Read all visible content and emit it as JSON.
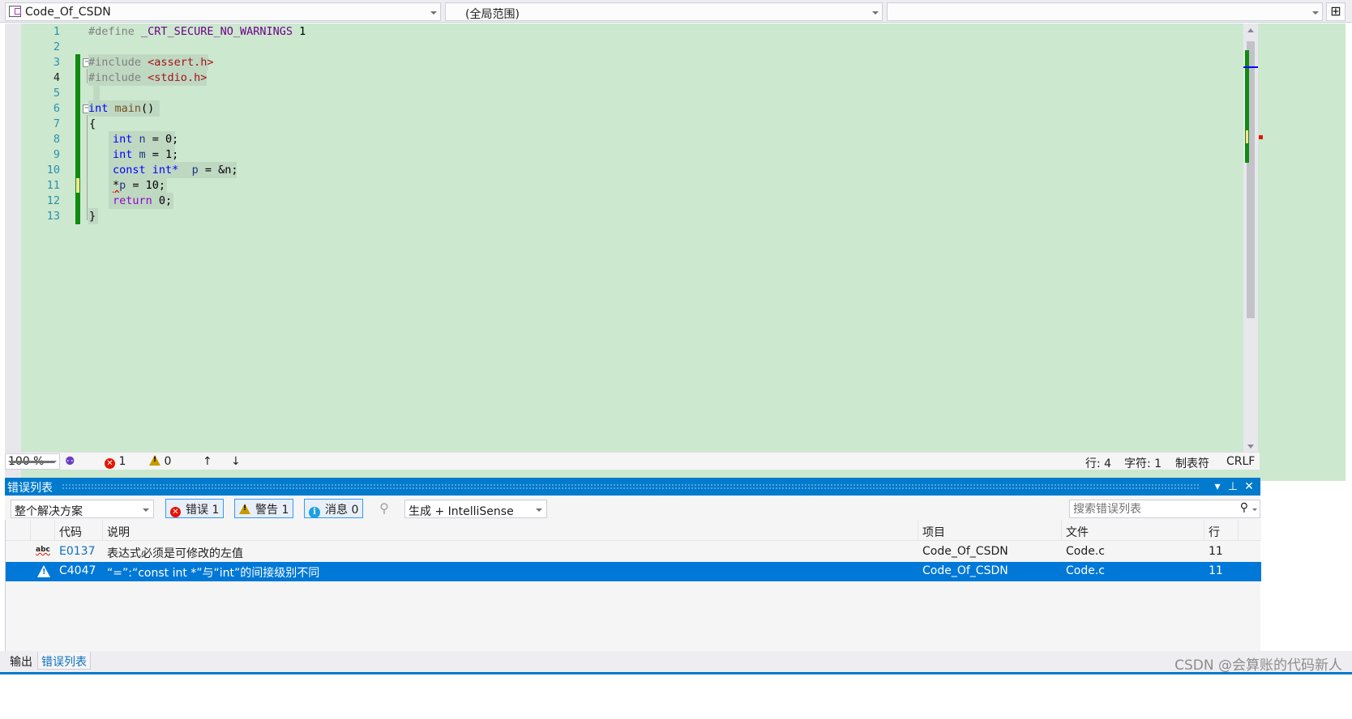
{
  "navbar": {
    "project": "Code_Of_CSDN",
    "scope": "(全局范围)",
    "member": "",
    "split_icon": "split-window-icon",
    "split_glyph": "⊞"
  },
  "editor": {
    "lines": [
      {
        "num": "1"
      },
      {
        "num": "2"
      },
      {
        "num": "3"
      },
      {
        "num": "4"
      },
      {
        "num": "5"
      },
      {
        "num": "6"
      },
      {
        "num": "7"
      },
      {
        "num": "8"
      },
      {
        "num": "9"
      },
      {
        "num": "10"
      },
      {
        "num": "11"
      },
      {
        "num": "12"
      },
      {
        "num": "13"
      }
    ],
    "tokens": {
      "define": "#define",
      "macro": "_CRT_SECURE_NO_WARNINGS",
      "one": " 1",
      "include": "#include",
      "assert_h": "<assert.h>",
      "stdio_h": "<stdio.h>",
      "int": "int",
      "main": "main",
      "parens": "()",
      "lbrace": "{",
      "rbrace": "}",
      "n": "n",
      "m": "m",
      "p": "p",
      "eq0": " = 0;",
      "eq1": " = 1;",
      "const": "const",
      "intptr": "int*",
      "eqamp": " = &n;",
      "star": "*",
      "eq10": " = 10;",
      "return": "return",
      "ret0": " 0;"
    }
  },
  "status": {
    "zoom": "100 %",
    "errors": "1",
    "warnings": "0",
    "up_arrow": "↑",
    "down_arrow": "↓",
    "row": "行: 4",
    "col": "字符: 1",
    "tabs": "制表符",
    "eol": "CRLF"
  },
  "error_list": {
    "title": "错误列表",
    "scope_select": "整个解决方案",
    "errors_btn": "错误 1",
    "warnings_btn": "警告 1",
    "messages_btn": "消息 0",
    "build_select": "生成 + IntelliSense",
    "search_placeholder": "搜索错误列表",
    "columns": {
      "code": "代码",
      "desc": "说明",
      "project": "项目",
      "file": "文件",
      "line": "行"
    },
    "rows": [
      {
        "icon": "abc",
        "code": "E0137",
        "desc": "表达式必须是可修改的左值",
        "project": "Code_Of_CSDN",
        "file": "Code.c",
        "line": "11"
      },
      {
        "icon": "warning",
        "code": "C4047",
        "desc": "“=”:“const int *”与“int”的间接级别不同",
        "project": "Code_Of_CSDN",
        "file": "Code.c",
        "line": "11"
      }
    ]
  },
  "bottom_tabs": {
    "output": "输出",
    "error_list": "错误列表"
  },
  "watermark": "CSDN @会算账的代码新人",
  "colors": {
    "editor_bg": "#cce8cf",
    "accent": "#007acc",
    "selection": "#0078d7",
    "change_bar": "#108b10"
  }
}
